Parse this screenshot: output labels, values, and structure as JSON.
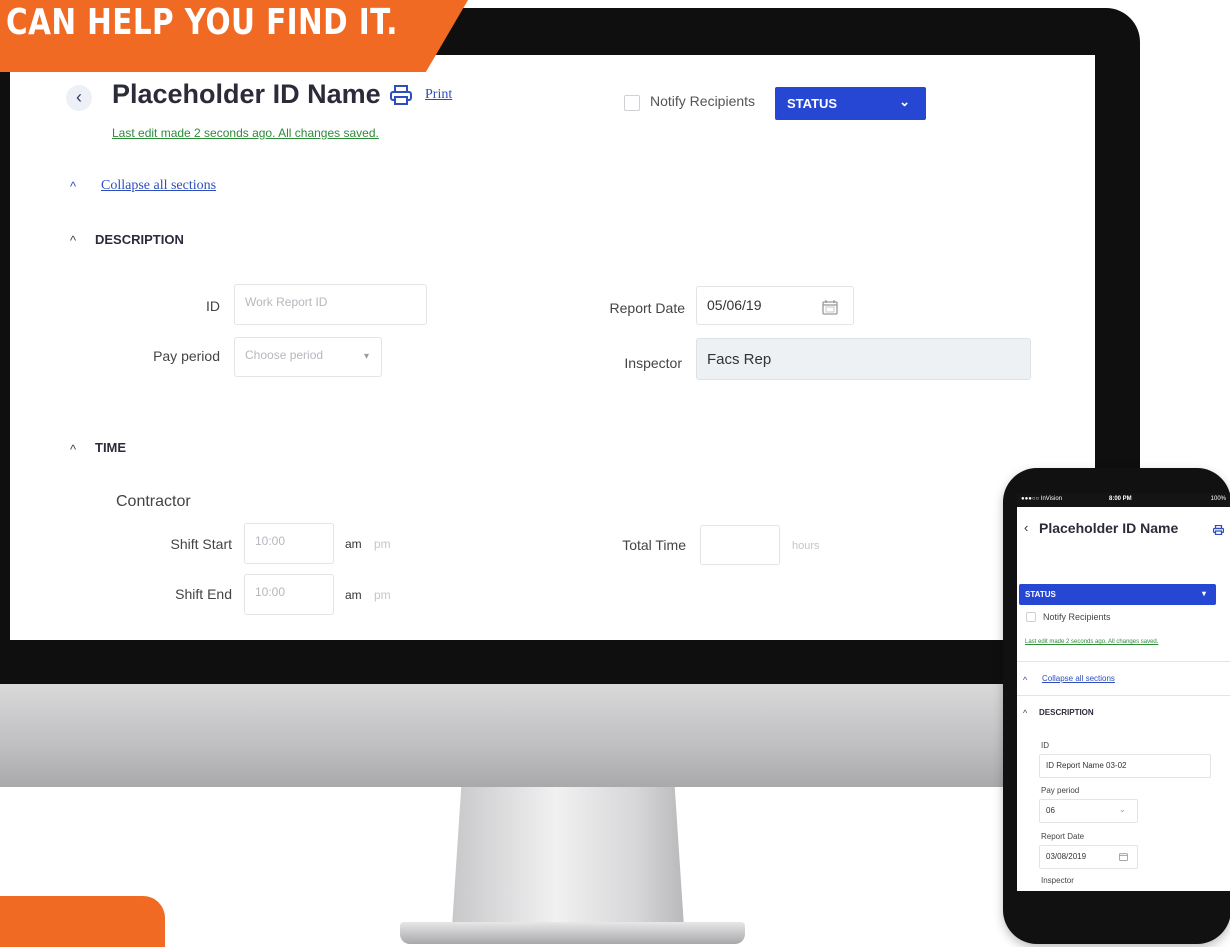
{
  "banner": {
    "text": "CAN HELP YOU FIND IT."
  },
  "desktop": {
    "header": {
      "back_icon": "‹",
      "title": "Placeholder ID Name",
      "print_label": "Print",
      "last_edit": "Last edit made 2 seconds ago. All changes saved.",
      "notify_label": "Notify Recipients",
      "status_label": "STATUS",
      "status_chevron": "⌄"
    },
    "collapse": {
      "chevron": "^",
      "label": "Collapse all sections"
    },
    "description": {
      "chevron": "^",
      "title": "DESCRIPTION",
      "id_label": "ID",
      "id_placeholder": "Work Report ID",
      "pay_period_label": "Pay period",
      "pay_period_placeholder": "Choose period",
      "pay_period_caret": "▾",
      "report_date_label": "Report Date",
      "report_date_value": "05/06/19",
      "inspector_label": "Inspector",
      "inspector_value": "Facs Rep"
    },
    "time": {
      "chevron": "^",
      "title": "TIME",
      "contractor_label": "Contractor",
      "shift_start_label": "Shift Start",
      "shift_start_placeholder": "10:00",
      "shift_end_label": "Shift End",
      "shift_end_placeholder": "10:00",
      "am": "am",
      "pm": "pm",
      "total_time_label": "Total Time",
      "hours_unit": "hours"
    },
    "colors": {
      "accent": "#2646d4",
      "link": "#2f4ebd",
      "saved": "#2e8b3a",
      "banner": "#f16a24"
    }
  },
  "mobile": {
    "status_bar": {
      "carrier": "●●●○○ InVision",
      "time": "8:00 PM",
      "battery": "100%"
    },
    "back_icon": "‹",
    "title": "Placeholder ID Name",
    "status_label": "STATUS",
    "status_chevron": "▾",
    "notify_label": "Notify Recipients",
    "last_edit": "Last edit made 2 seconds ago. All changes saved.",
    "collapse_chevron": "^",
    "collapse_label": "Collapse all sections",
    "section_chevron": "^",
    "section_title": "DESCRIPTION",
    "id_label": "ID",
    "id_value": "ID Report Name 03-02",
    "pay_period_label": "Pay period",
    "pay_period_value": "06",
    "pay_period_caret": "⌄",
    "report_date_label": "Report Date",
    "report_date_value": "03/08/2019",
    "inspector_label": "Inspector"
  }
}
